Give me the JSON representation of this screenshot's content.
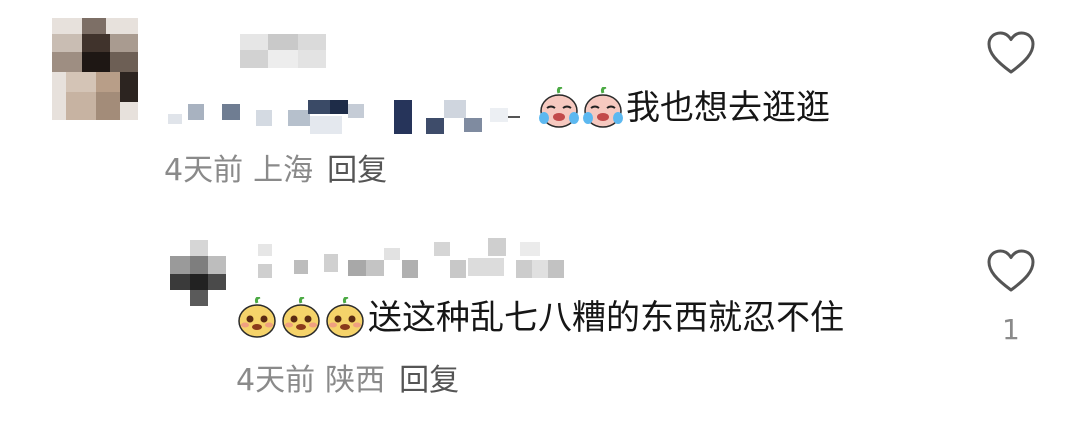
{
  "comments": [
    {
      "text": "我也想去逛逛",
      "time": "4天前",
      "location": "上海",
      "reply_label": "回复",
      "emoji": [
        "crying-face-emoji",
        "crying-face-emoji"
      ]
    },
    {
      "text": "送这种乱七八糟的东西就忍不住",
      "time": "4天前",
      "location": "陕西",
      "reply_label": "回复",
      "like_count": "1",
      "emoji": [
        "smug-face-emoji",
        "smug-face-emoji",
        "smug-face-emoji"
      ]
    }
  ],
  "icons": {
    "like": "heart-outline-icon"
  },
  "colors": {
    "text": "#161616",
    "meta": "#8a8a8a",
    "reply": "#555555",
    "heart": "#555555"
  }
}
